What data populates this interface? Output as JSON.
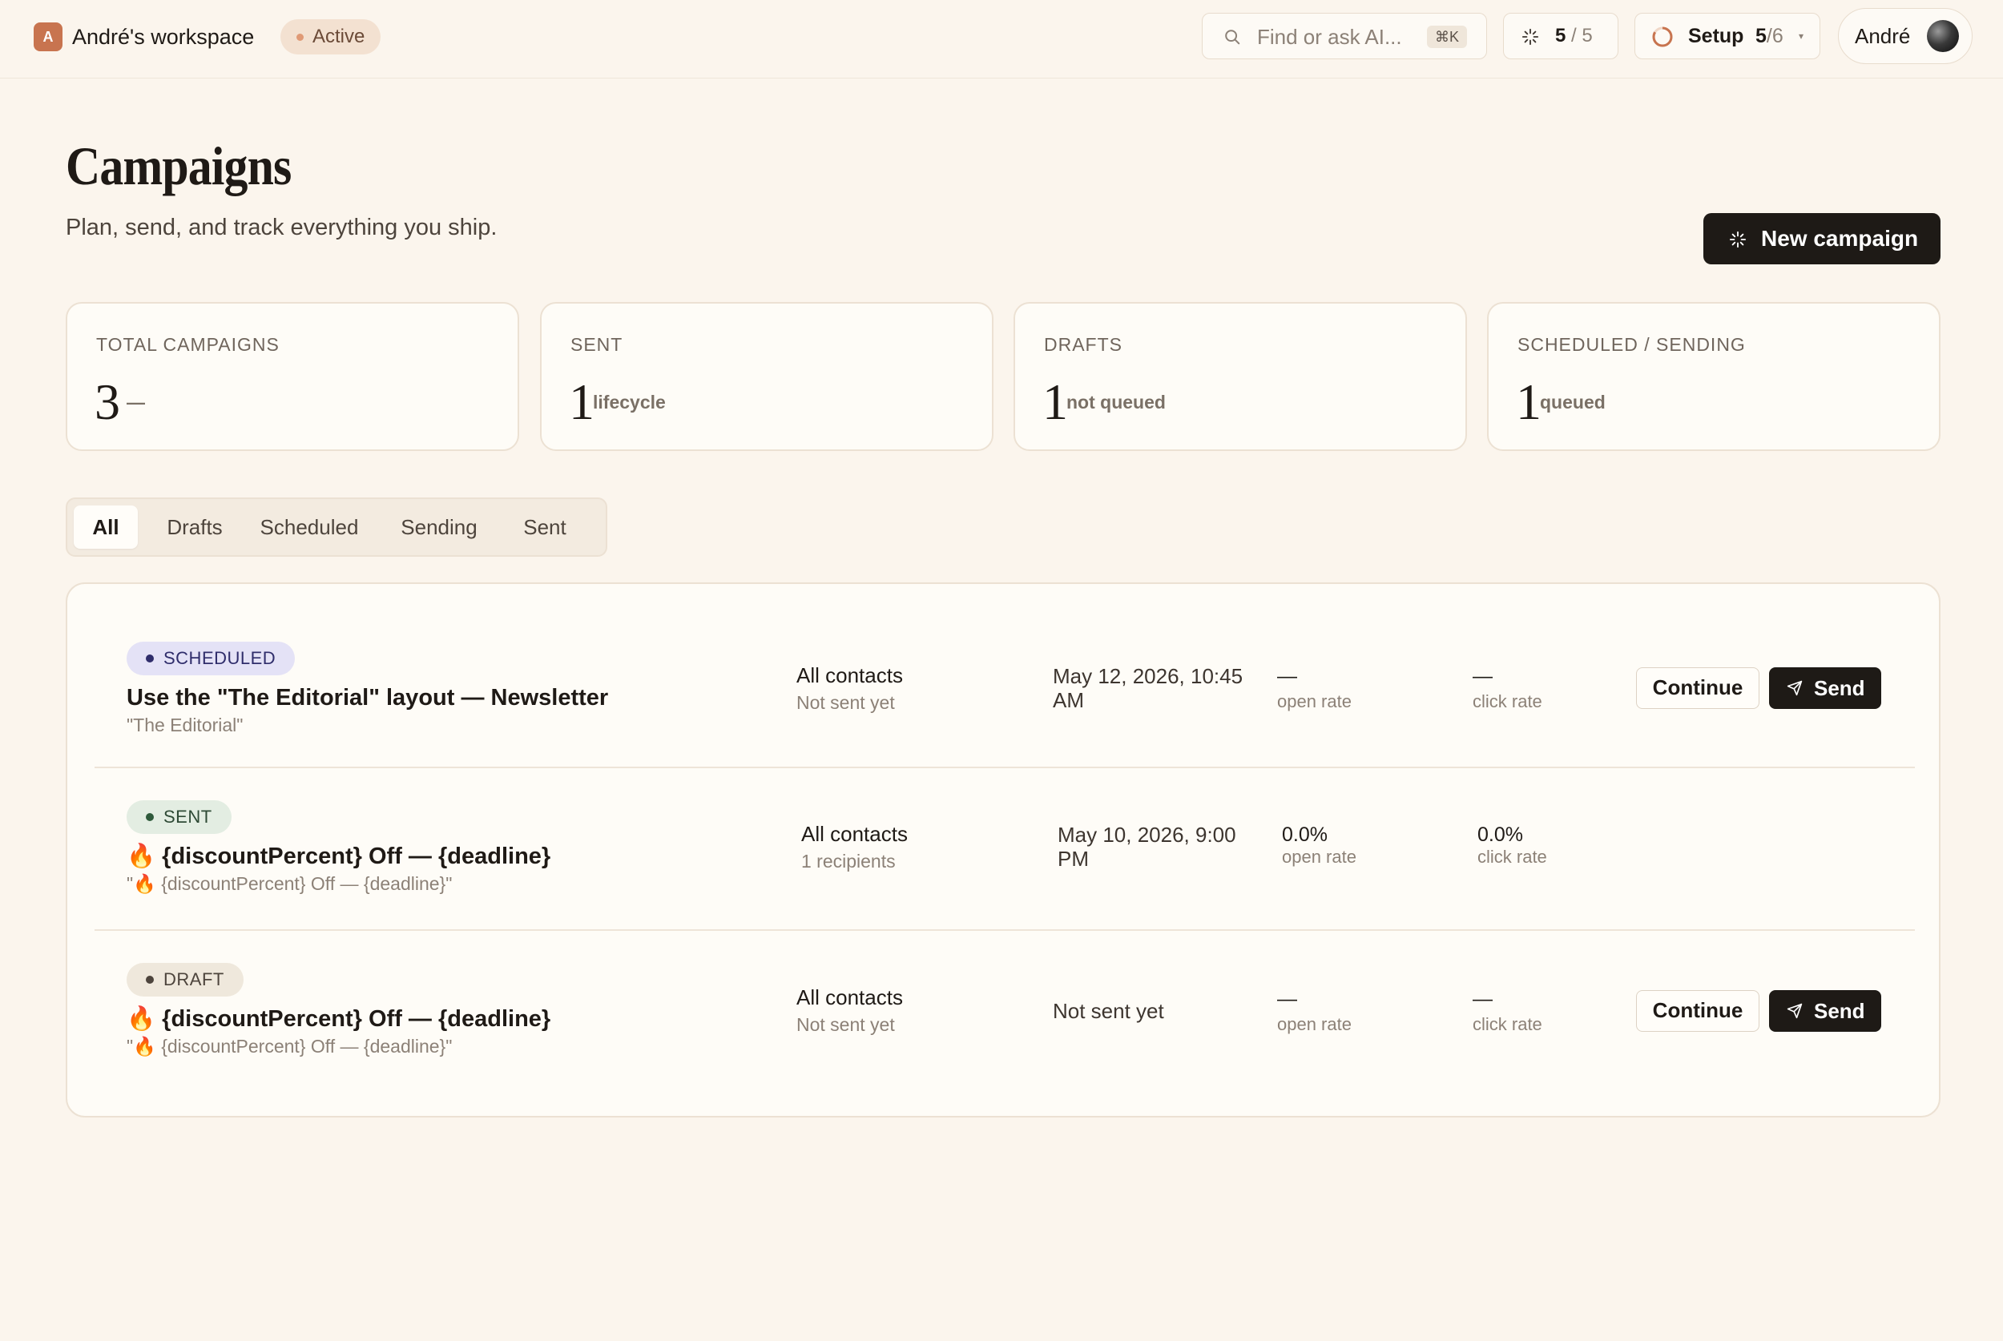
{
  "topbar": {
    "workspace_initial": "A",
    "workspace_name": "André's workspace",
    "status": "Active",
    "search_placeholder": "Find or ask AI...",
    "search_shortcut": "⌘K",
    "credits_used": "5",
    "credits_sep": " / ",
    "credits_total": "5",
    "setup_label": "Setup",
    "setup_done": "5",
    "setup_total": "/6",
    "setup_chevron": "▾",
    "user_name": "André"
  },
  "header": {
    "title": "Campaigns",
    "subtitle": "Plan, send, and track everything you ship.",
    "new_button": "New campaign"
  },
  "stats": [
    {
      "label": "TOTAL CAMPAIGNS",
      "value": "3",
      "hint": "—"
    },
    {
      "label": "SENT",
      "value": "1",
      "hint": "lifecycle"
    },
    {
      "label": "DRAFTS",
      "value": "1",
      "hint": "not queued"
    },
    {
      "label": "SCHEDULED / SENDING",
      "value": "1",
      "hint": "queued"
    }
  ],
  "tabs": [
    "All",
    "Drafts",
    "Scheduled",
    "Sending",
    "Sent"
  ],
  "active_tab": "All",
  "campaigns": [
    {
      "status": "SCHEDULED",
      "title": "Use the \"The Editorial\" layout — Newsletter",
      "subtitle": "\"The Editorial\"",
      "audience": "All contacts",
      "audience_sub": "Not sent yet",
      "date": "May 12, 2026, 10:45 AM",
      "open_value": "—",
      "open_label": "open rate",
      "click_value": "—",
      "click_label": "click rate",
      "continue_label": "Continue",
      "send_label": "Send"
    },
    {
      "status": "SENT",
      "title": "🔥 {discountPercent} Off — {deadline}",
      "subtitle": "\"🔥 {discountPercent} Off — {deadline}\"",
      "audience": "All contacts",
      "audience_sub": "1 recipients",
      "date": "May 10, 2026, 9:00 PM",
      "open_value": "0.0%",
      "open_label": "open rate",
      "click_value": "0.0%",
      "click_label": "click rate"
    },
    {
      "status": "DRAFT",
      "title": "🔥 {discountPercent} Off — {deadline}",
      "subtitle": "\"🔥 {discountPercent} Off — {deadline}\"",
      "audience": "All contacts",
      "audience_sub": "Not sent yet",
      "date": "Not sent yet",
      "open_value": "—",
      "open_label": "open rate",
      "click_value": "—",
      "click_label": "click rate",
      "continue_label": "Continue",
      "send_label": "Send"
    }
  ],
  "colors": {
    "background": "#fbf5ed",
    "primary_button": "#1e1a16",
    "accent": "#c8744f"
  }
}
